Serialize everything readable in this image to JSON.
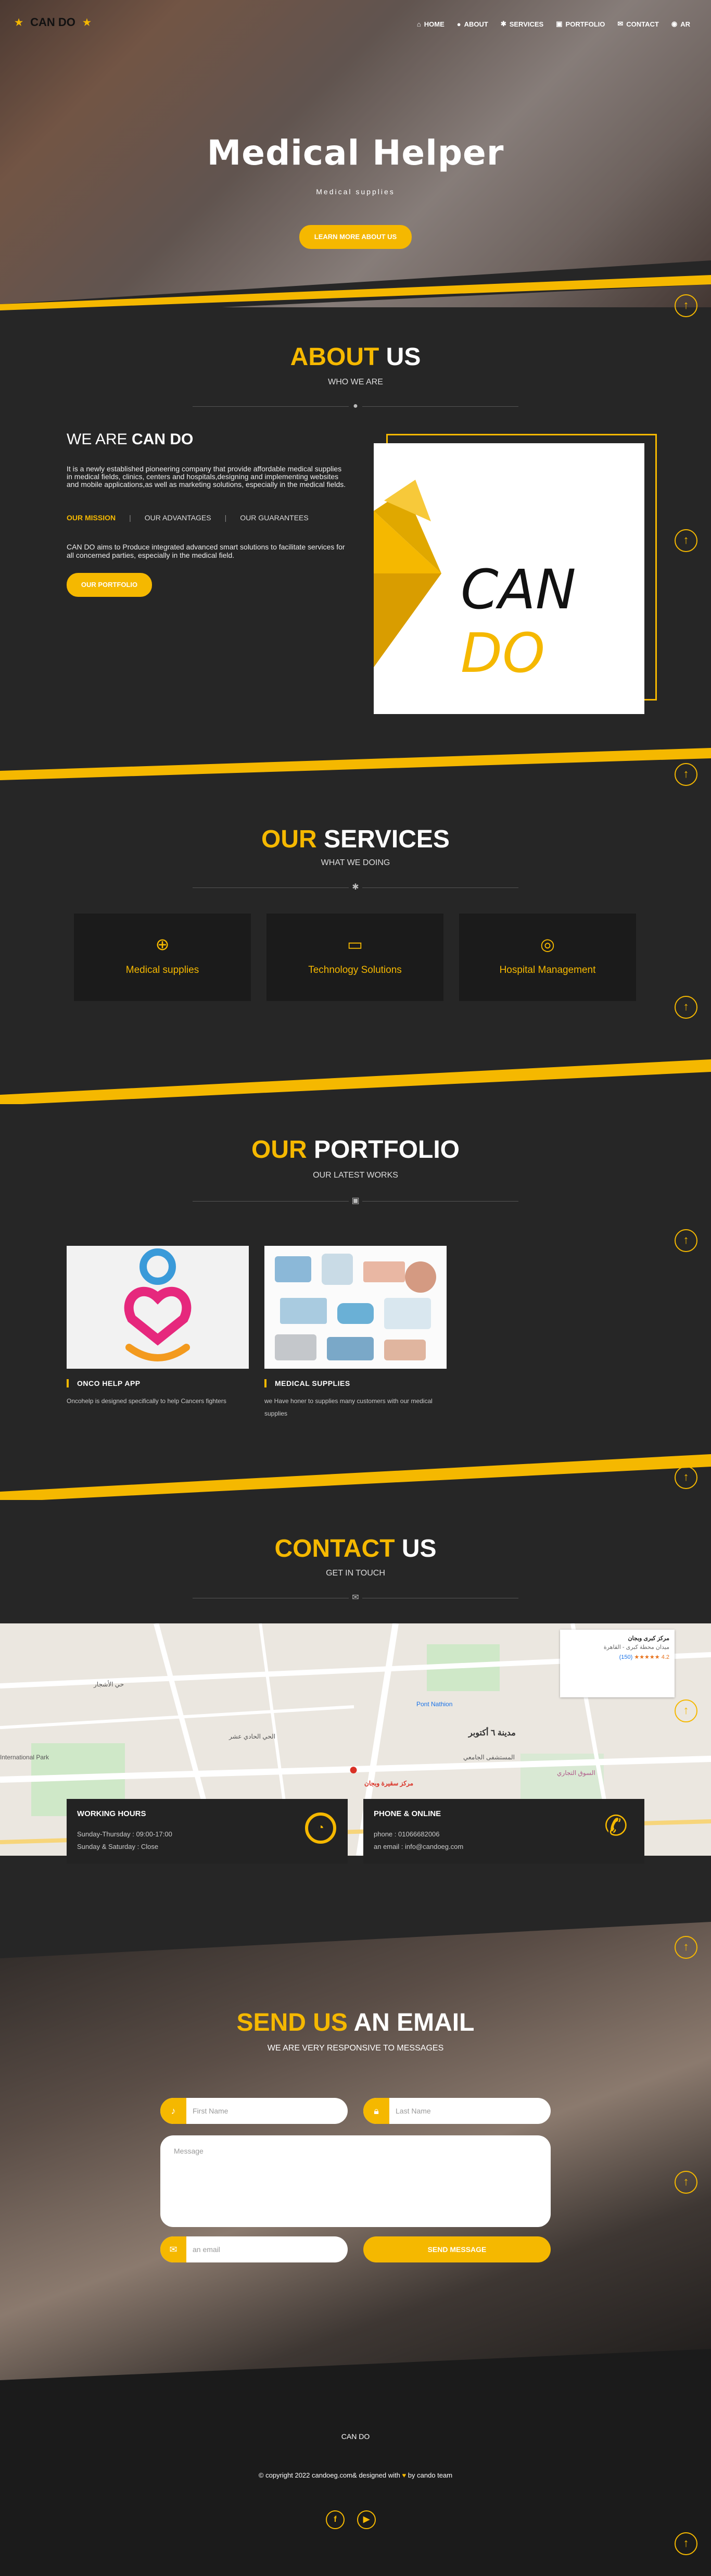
{
  "header": {
    "brand": "CAN DO",
    "nav": [
      {
        "icon": "home-icon",
        "glyph": "⌂",
        "label": "HOME"
      },
      {
        "icon": "user-icon",
        "glyph": "●",
        "label": "ABOUT"
      },
      {
        "icon": "gear-icon",
        "glyph": "✱",
        "label": "SERVICES"
      },
      {
        "icon": "image-icon",
        "glyph": "▣",
        "label": "PORTFOLIO"
      },
      {
        "icon": "envelope-icon",
        "glyph": "✉",
        "label": "CONTACT"
      },
      {
        "icon": "globe-icon",
        "glyph": "◉",
        "label": "AR"
      }
    ]
  },
  "hero": {
    "title": "Medical Helper",
    "subtitle": "Medical supplies",
    "button": "LEARN MORE ABOUT US"
  },
  "about": {
    "title_accent": "ABOUT",
    "title_rest": "US",
    "subtitle": "WHO WE ARE",
    "heading_prefix": "WE ARE",
    "heading_bold": "CAN DO",
    "paragraph": "It is a newly established pioneering company that provide affordable medical supplies in medical fields, clinics, centers and hospitals,designing and implementing websites and mobile applications,as well as marketing solutions, especially in the medical fields.",
    "tabs": [
      "OUR MISSION",
      "OUR ADVANTAGES",
      "OUR GUARANTEES"
    ],
    "mission_text": "CAN DO aims to Produce integrated advanced smart solutions to facilitate services for all concerned parties, especially in the medical field.",
    "button": "OUR PORTFOLIO",
    "logo_text_dark": "CAN",
    "logo_text_accent": "DO"
  },
  "services": {
    "title_accent": "OUR",
    "title_rest": "SERVICES",
    "subtitle": "WHAT WE DOING",
    "items": [
      {
        "icon": "plus-circle-icon",
        "glyph": "⊕",
        "label": "Medical supplies"
      },
      {
        "icon": "desktop-icon",
        "glyph": "▭",
        "label": "Technology Solutions"
      },
      {
        "icon": "lifebuoy-icon",
        "glyph": "◎",
        "label": "Hospital Management"
      }
    ]
  },
  "portfolio": {
    "title_accent": "OUR",
    "title_rest": "PORTFOLIO",
    "subtitle": "OUR LATEST WORKS",
    "items": [
      {
        "title": "ONCO HELP APP",
        "desc": "Oncohelp is designed specifically to help Cancers fighters"
      },
      {
        "title": "MEDICAL SUPPLIES",
        "desc": "we Have honer to supplies many customers with our medical supplies"
      }
    ]
  },
  "contact": {
    "title_accent": "CONTACT",
    "title_rest": "US",
    "subtitle": "GET IN TOUCH",
    "map": {
      "place_title": "مركز كبرى وبجان",
      "place_addr": "ميدان محطة كبرى - القاهرة",
      "rating": "4.2",
      "rating_count": "(150)",
      "marker_label": "مركز سقيرة وبجان",
      "area_label": "مدينة ٦ أكتوبر",
      "labels": [
        "الحي الحادي عشر",
        "المستشفى الجامعي",
        "حي الأشجار",
        "Pont Nathion",
        "International Park",
        "السوق التجاري"
      ]
    },
    "working": {
      "title": "WORKING HOURS",
      "line1": "Sunday-Thursday : 09:00-17:00",
      "line2": "Sunday & Saturday : Close"
    },
    "phone": {
      "title": "PHONE & ONLINE",
      "line1": "phone : 01066682006",
      "line2": "an email : info@candoeg.com"
    }
  },
  "email": {
    "title_accent": "SEND US",
    "title_rest": "AN EMAIL",
    "subtitle": "WE ARE VERY RESPONSIVE TO MESSAGES",
    "first_name_placeholder": "First Name",
    "last_name_placeholder": "Last Name",
    "message_placeholder": "Message",
    "email_placeholder": "an email",
    "button": "SEND MESSAGE"
  },
  "footer": {
    "name": "CAN DO",
    "copy_before": "© copyright 2022 candoeg.com& designed with",
    "copy_after": "by cando team",
    "social": [
      {
        "icon": "facebook-icon",
        "glyph": "f"
      },
      {
        "icon": "youtube-icon",
        "glyph": "▶"
      }
    ]
  },
  "colors": {
    "accent": "#f5b800",
    "background": "#262626",
    "card": "#1b1b1b"
  }
}
